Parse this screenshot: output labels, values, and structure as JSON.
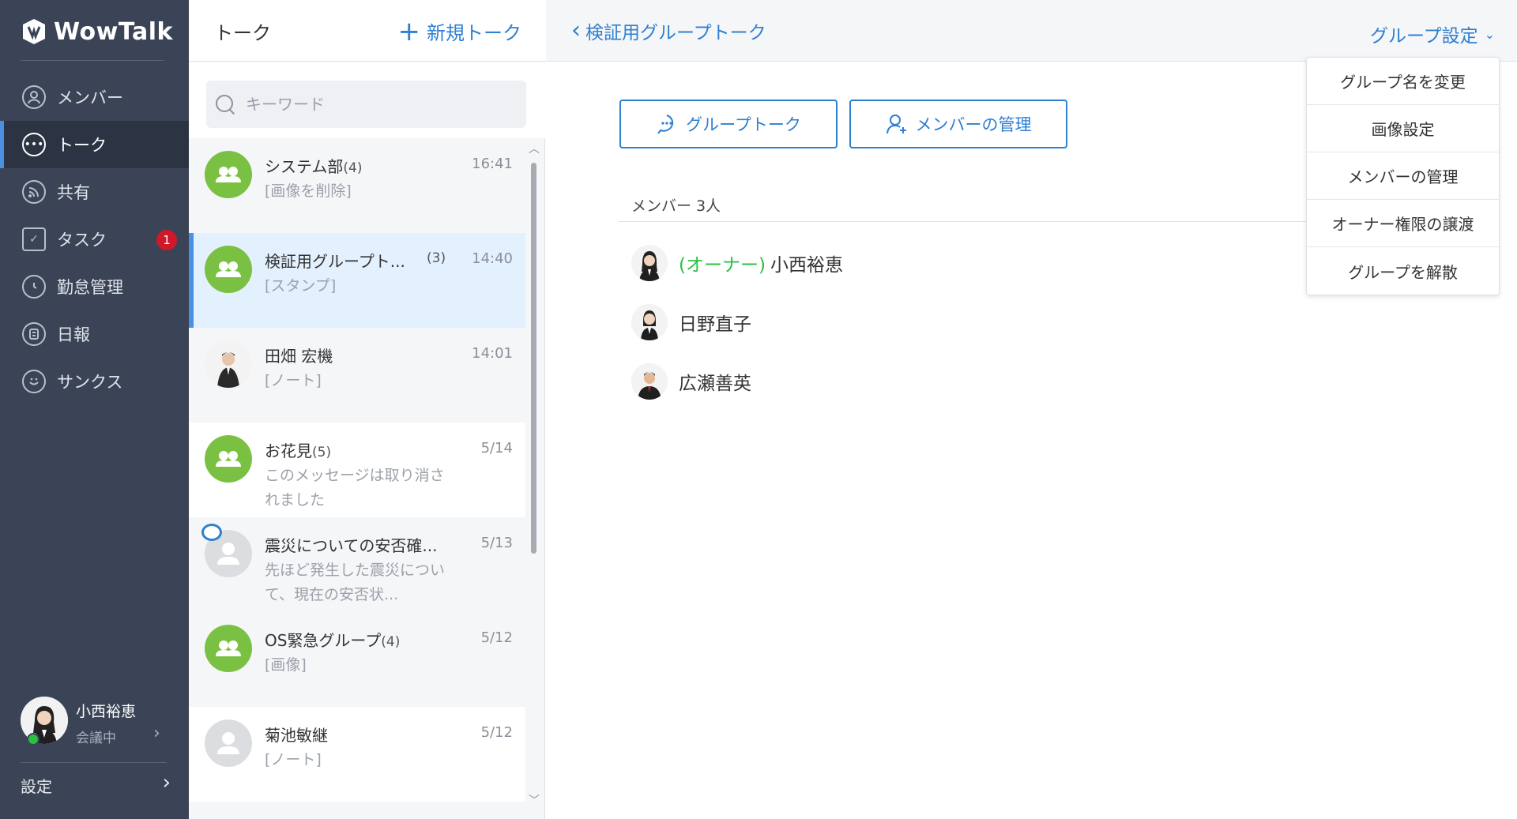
{
  "app": {
    "name": "WowTalk"
  },
  "sidebar": {
    "items": [
      {
        "label": "メンバー",
        "icon": "person-icon"
      },
      {
        "label": "トーク",
        "icon": "chat-icon",
        "active": true
      },
      {
        "label": "共有",
        "icon": "share-icon"
      },
      {
        "label": "タスク",
        "icon": "clipboard-icon",
        "badge": "1"
      },
      {
        "label": "勤怠管理",
        "icon": "clock-icon"
      },
      {
        "label": "日報",
        "icon": "report-icon"
      },
      {
        "label": "サンクス",
        "icon": "smile-icon"
      }
    ],
    "profile": {
      "name": "小西裕恵",
      "status": "会議中"
    },
    "settings_label": "設定"
  },
  "talk_list": {
    "title": "トーク",
    "new_talk_label": "新規トーク",
    "search_placeholder": "キーワード",
    "items": [
      {
        "name": "システム部",
        "count": "(4)",
        "time": "16:41",
        "message": "[画像を削除]",
        "avatar": "group"
      },
      {
        "name": "検証用グループト...",
        "count": "(3)",
        "time": "14:40",
        "message": "[スタンプ]",
        "avatar": "group",
        "active": true
      },
      {
        "name": "田畑 宏機",
        "count": "",
        "time": "14:01",
        "message": "[ノート]",
        "avatar": "photo-man"
      },
      {
        "name": "お花見",
        "count": "(5)",
        "time": "5/14",
        "message": "このメッセージは取り消されました",
        "avatar": "group"
      },
      {
        "name": "震災についての安否確...",
        "count": "",
        "time": "5/13",
        "message": "先ほど発生した震災について、現在の安否状...",
        "avatar": "gray"
      },
      {
        "name": "OS緊急グループ",
        "count": "(4)",
        "time": "5/12",
        "message": "[画像]",
        "avatar": "group"
      },
      {
        "name": "菊池敏継",
        "count": "",
        "time": "5/12",
        "message": "[ノート]",
        "avatar": "gray"
      }
    ]
  },
  "main": {
    "back_label": "検証用グループトーク",
    "group_settings_label": "グループ設定",
    "group_talk_button": "グループトーク",
    "manage_members_button": "メンバーの管理",
    "member_header": "メンバー 3人",
    "owner_tag": "(オーナー)",
    "members": [
      {
        "name": "小西裕恵",
        "owner": true
      },
      {
        "name": "日野直子",
        "owner": false
      },
      {
        "name": "広瀬善英",
        "owner": false
      }
    ],
    "dropdown": [
      "グループ名を変更",
      "画像設定",
      "メンバーの管理",
      "オーナー権限の譲渡",
      "グループを解散"
    ]
  },
  "colors": {
    "sidebar_bg": "#3b4456",
    "accent_blue": "#2f80d1",
    "group_green": "#7ac143",
    "owner_green": "#29c141",
    "badge_red": "#d0182b"
  }
}
